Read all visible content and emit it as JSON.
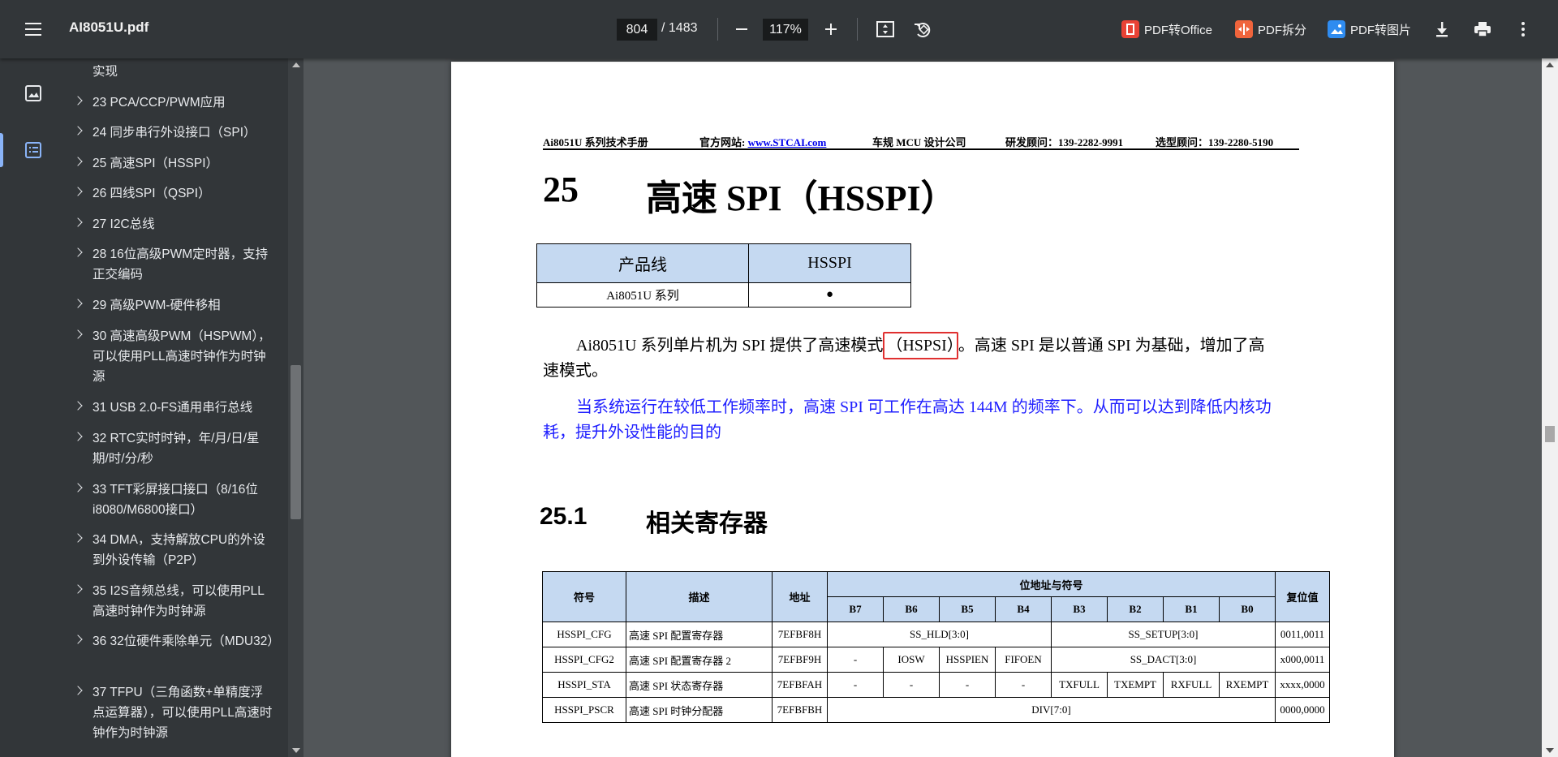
{
  "toolbar": {
    "title": "AI8051U.pdf",
    "page_current": "804",
    "page_total": "/ 1483",
    "zoom": "117%",
    "ext_buttons": [
      "PDF转Office",
      "PDF拆分",
      "PDF转图片"
    ]
  },
  "outline": {
    "items": [
      "实现",
      "23 PCA/CCP/PWM应用",
      "24 同步串行外设接口（SPI）",
      "25 高速SPI（HSSPI）",
      "26 四线SPI（QSPI）",
      "27 I2C总线",
      "28 16位高级PWM定时器，支持正交编码",
      "29 高级PWM-硬件移相",
      "30 高速高级PWM（HSPWM），可以使用PLL高速时钟作为时钟源",
      "31 USB 2.0-FS通用串行总线",
      "32 RTC实时时钟，年/月/日/星期/时/分/秒",
      "33 TFT彩屏接口接口（8/16位i8080/M6800接口）",
      "34 DMA，支持解放CPU的外设到外设传输（P2P）",
      "35 I2S音频总线，可以使用PLL高速时钟作为时钟源",
      "36 32位硬件乘除单元（MDU32）",
      "37 TFPU（三角函数+单精度浮点运算器），可以使用PLL高速时钟作为时钟源"
    ]
  },
  "doc": {
    "header": {
      "manual": "Ai8051U 系列技术手册",
      "site_label": "官方网站: ",
      "site_url": "www.STCAI.com",
      "company": "车规 MCU 设计公司",
      "rd": "研发顾问：139-2282-9991",
      "sel": "选型顾问：139-2280-5190"
    },
    "chapter_num": "25",
    "chapter_title": "高速 SPI（HSSPI）",
    "product_table": {
      "h1": "产品线",
      "h2": "HSSPI",
      "r1": "Ai8051U 系列",
      "r2": "●"
    },
    "para1_a": "Ai8051U 系列单片机为 SPI 提供了高速模式",
    "para1_hl": "（HSPSI）",
    "para1_b": "。高速 SPI 是以普通 SPI 为基础，增加了高",
    "para1_c": "速模式。",
    "para2_a": "当系统运行在较低工作频率时，高速 SPI 可工作在高达 144M 的频率下。从而可以达到降低内核功",
    "para2_b": "耗，提升外设性能的目的",
    "section_num": "25.1",
    "section_title": "相关寄存器",
    "reg_table": {
      "h_sym": "符号",
      "h_desc": "描述",
      "h_addr": "地址",
      "h_bits": "位地址与符号",
      "h_reset": "复位值",
      "bits": [
        "B7",
        "B6",
        "B5",
        "B4",
        "B3",
        "B2",
        "B1",
        "B0"
      ],
      "r1": [
        "HSSPI_CFG",
        "高速 SPI 配置寄存器",
        "7EFBF8H",
        "SS_HLD[3:0]",
        "SS_SETUP[3:0]",
        "0011,0011"
      ],
      "r2": [
        "HSSPI_CFG2",
        "高速 SPI 配置寄存器 2",
        "7EFBF9H",
        "-",
        "IOSW",
        "HSSPIEN",
        "FIFOEN",
        "SS_DACT[3:0]",
        "x000,0011"
      ],
      "r3": [
        "HSSPI_STA",
        "高速 SPI 状态寄存器",
        "7EFBFAH",
        "-",
        "-",
        "-",
        "-",
        "TXFULL",
        "TXEMPT",
        "RXFULL",
        "RXEMPT",
        "xxxx,0000"
      ],
      "r4": [
        "HSSPI_PSCR",
        "高速 SPI 时钟分配器",
        "7EFBFBH",
        "DIV[7:0]",
        "0000,0000"
      ]
    }
  }
}
